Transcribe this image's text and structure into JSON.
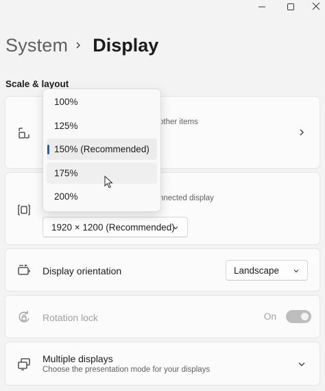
{
  "breadcrumb": {
    "parent": "System",
    "current": "Display"
  },
  "section_title": "Scale & layout",
  "scale_card": {
    "subtitle_fragment": "other items"
  },
  "resolution_card": {
    "subtitle_fragment": "nnected display",
    "select_value": "1920 × 1200 (Recommended)"
  },
  "orientation_card": {
    "title": "Display orientation",
    "select_value": "Landscape"
  },
  "rotation_card": {
    "title": "Rotation lock",
    "toggle_label": "On"
  },
  "multiple_card": {
    "title": "Multiple displays",
    "subtitle": "Choose the presentation mode for your displays"
  },
  "scale_dropdown": {
    "options": [
      "100%",
      "125%",
      "150% (Recommended)",
      "175%",
      "200%"
    ],
    "selected": "150% (Recommended)",
    "hovered": "175%"
  },
  "colors": {
    "accent": "#1e5fa8",
    "toggle_disabled": "#bdbdbd"
  }
}
